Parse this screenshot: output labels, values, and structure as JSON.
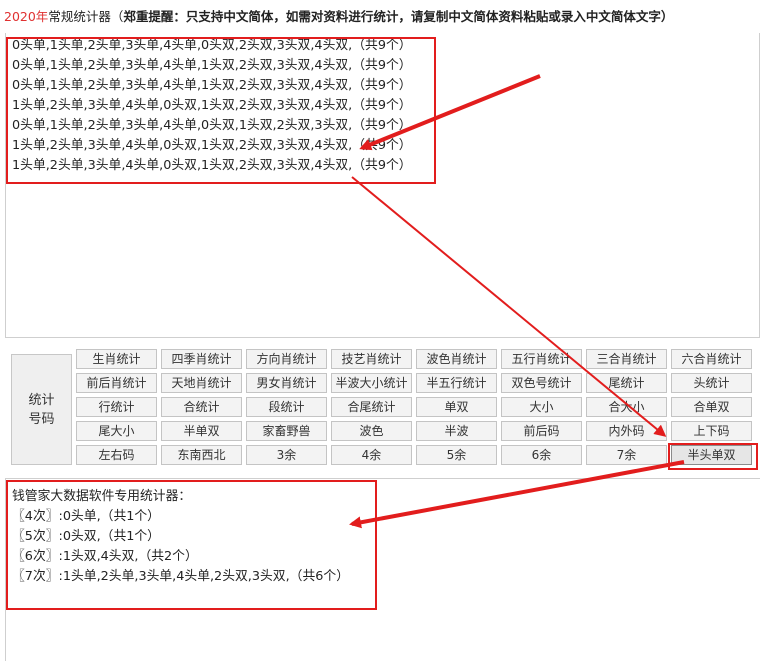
{
  "header": {
    "year": "2020年",
    "app_title": "常规统计器（",
    "warning": "郑重提醒：只支持中文简体，如需对资料进行统计，请复制中文简体资料粘贴或录入中文简体文字）"
  },
  "input": {
    "lines": [
      "0头单,1头单,2头单,3头单,4头单,0头双,2头双,3头双,4头双,（共9个）",
      "0头单,1头单,2头单,3头单,4头单,1头双,2头双,3头双,4头双,（共9个）",
      "0头单,1头单,2头单,3头单,4头单,1头双,2头双,3头双,4头双,（共9个）",
      "1头单,2头单,3头单,4头单,0头双,1头双,2头双,3头双,4头双,（共9个）",
      "0头单,1头单,2头单,3头单,4头单,0头双,1头双,2头双,3头双,（共9个）",
      "1头单,2头单,3头单,4头单,0头双,1头双,2头双,3头双,4头双,（共9个）",
      "1头单,2头单,3头单,4头单,0头双,1头双,2头双,3头双,4头双,（共9个）"
    ]
  },
  "side_button": {
    "line1": "统计",
    "line2": "号码"
  },
  "buttons": [
    [
      "生肖统计",
      "四季肖统计",
      "方向肖统计",
      "技艺肖统计",
      "波色肖统计",
      "五行肖统计",
      "三合肖统计",
      "六合肖统计"
    ],
    [
      "前后肖统计",
      "天地肖统计",
      "男女肖统计",
      "半波大小统计",
      "半五行统计",
      "双色号统计",
      "尾统计",
      "头统计"
    ],
    [
      "行统计",
      "合统计",
      "段统计",
      "合尾统计",
      "单双",
      "大小",
      "合大小",
      "合单双"
    ],
    [
      "尾大小",
      "半单双",
      "家畜野兽",
      "波色",
      "半波",
      "前后码",
      "内外码",
      "上下码"
    ],
    [
      "左右码",
      "东南西北",
      "3余",
      "4余",
      "5余",
      "6余",
      "7余",
      "半头单双"
    ]
  ],
  "result": {
    "lines": [
      "钱管家大数据软件专用统计器：",
      "〖4次〗:0头单,（共1个）",
      "〖5次〗:0头双,（共1个）",
      "〖6次〗:1头双,4头双,（共2个）",
      "〖7次〗:1头单,2头单,3头单,4头单,2头双,3头双,（共6个）"
    ]
  },
  "colors": {
    "highlight": "#e21d1d",
    "year": "#e03131"
  }
}
